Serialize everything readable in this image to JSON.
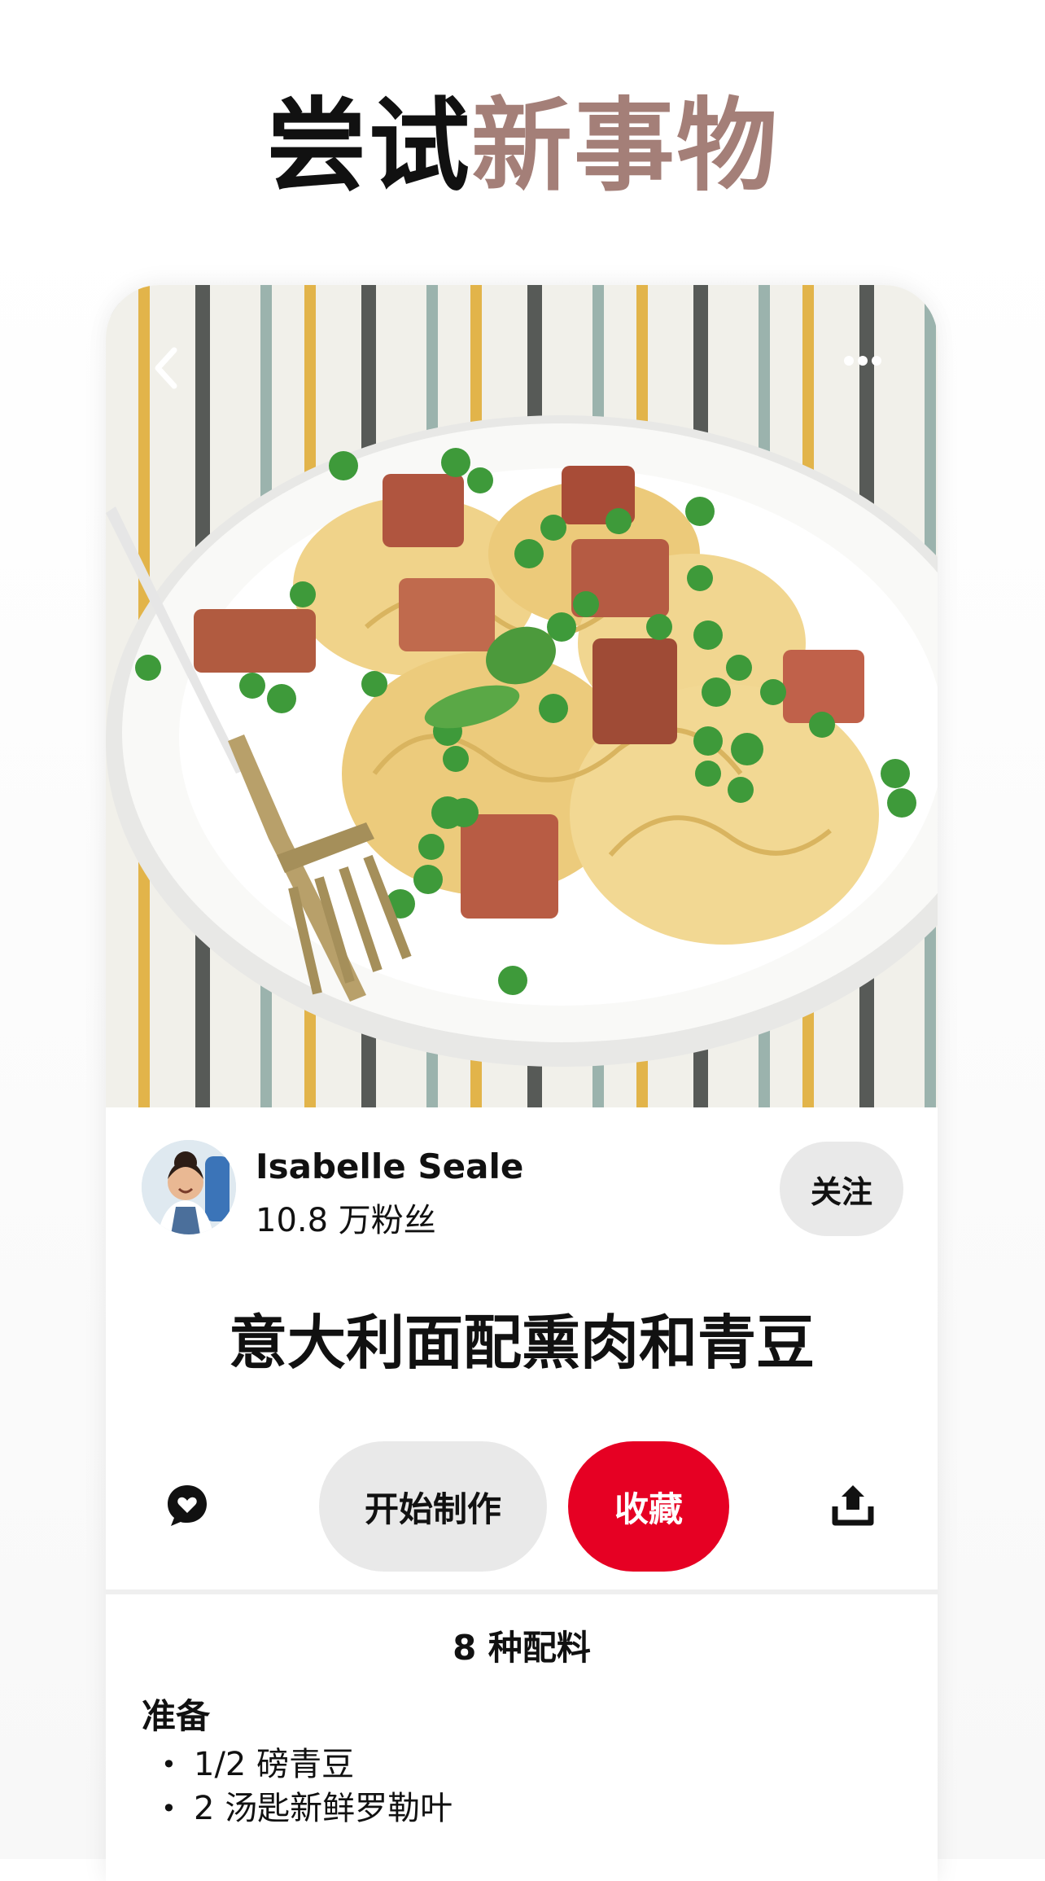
{
  "headline": {
    "dark": "尝试",
    "accent": "新事物"
  },
  "colors": {
    "accent": "#a47f78",
    "primary_button": "#e60023",
    "secondary_button": "#e9e9e9"
  },
  "hero": {
    "back_icon": "chevron-left-icon",
    "more_icon": "more-dots-icon"
  },
  "author": {
    "name": "Isabelle Seale",
    "followers": "10.8 万粉丝",
    "follow_label": "关注"
  },
  "recipe": {
    "title": "意大利面配熏肉和青豆"
  },
  "actions": {
    "comment_icon": "comment-heart-icon",
    "make_label": "开始制作",
    "save_label": "收藏",
    "share_icon": "share-icon"
  },
  "ingredients": {
    "count_label": "8 种配料",
    "section_title": "准备",
    "items": [
      "1/2 磅青豆",
      "2 汤匙新鲜罗勒叶"
    ]
  }
}
